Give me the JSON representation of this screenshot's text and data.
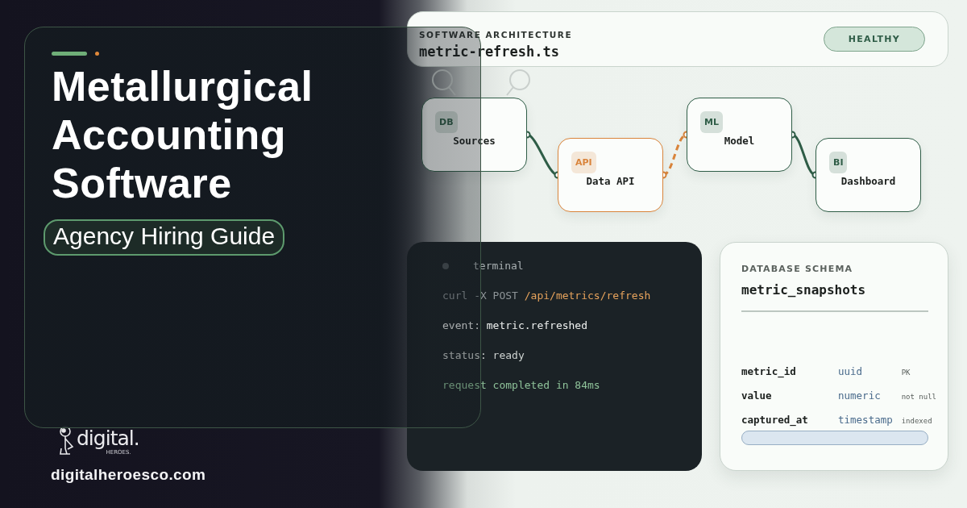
{
  "hero": {
    "title": "Metallurgical Accounting Software",
    "subtitle": "Agency Hiring Guide"
  },
  "brand": {
    "logo_text": "digital.",
    "logo_subtext": "HEROES.",
    "url": "digitalheroesco.com"
  },
  "architecture": {
    "label": "SOFTWARE ARCHITECTURE",
    "file": "metric-refresh.ts",
    "status": "HEALTHY"
  },
  "pipeline": {
    "nodes": [
      {
        "badge": "DB",
        "name": "Sources",
        "color": "#2f5d47"
      },
      {
        "badge": "API",
        "name": "Data API",
        "color": "#d9843b"
      },
      {
        "badge": "ML",
        "name": "Model",
        "color": "#2f5d47"
      },
      {
        "badge": "BI",
        "name": "Dashboard",
        "color": "#2f5d47"
      }
    ],
    "edges": [
      {
        "kind": "solid"
      },
      {
        "kind": "dashed"
      },
      {
        "kind": "solid"
      }
    ]
  },
  "terminal": {
    "title": "terminal",
    "lines": [
      [
        {
          "text": "curl -X POST ",
          "kind": "muted"
        },
        {
          "text": "/api/metrics/refresh",
          "kind": "path"
        }
      ],
      [
        {
          "text": "event: metric.refreshed",
          "kind": "plain"
        }
      ],
      [
        {
          "text": "status: ready",
          "kind": "soft"
        }
      ],
      [
        {
          "text": "request completed in 84ms",
          "kind": "success"
        }
      ]
    ]
  },
  "schema": {
    "label": "DATABASE SCHEMA",
    "table": "metric_snapshots",
    "fields": [
      {
        "name": "metric_id",
        "type": "uuid",
        "constraint": "PK"
      },
      {
        "name": "value",
        "type": "numeric",
        "constraint": "not null"
      },
      {
        "name": "captured_at",
        "type": "timestamp",
        "constraint": "indexed"
      }
    ]
  }
}
